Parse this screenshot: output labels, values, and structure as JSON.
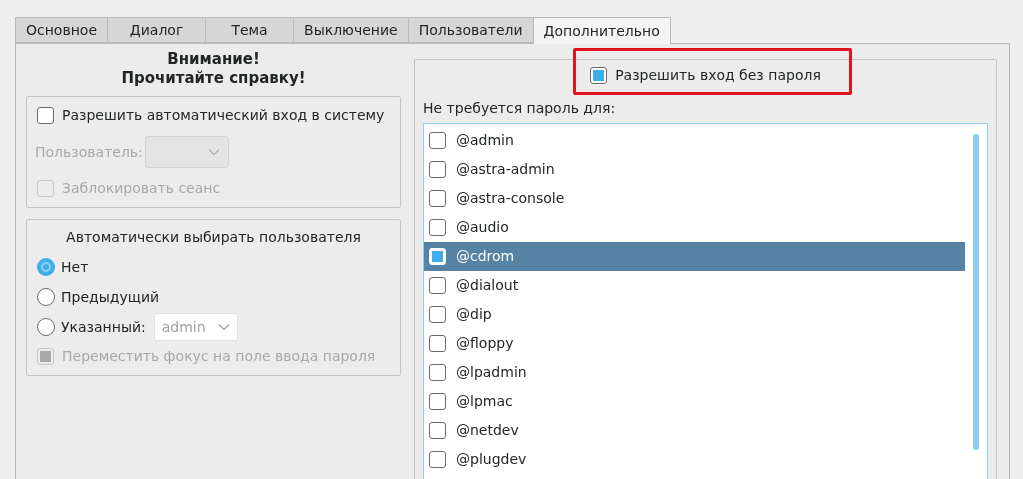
{
  "tabs": [
    {
      "label": "Основное",
      "selected": false
    },
    {
      "label": "Диалог",
      "selected": false
    },
    {
      "label": "Тема",
      "selected": false
    },
    {
      "label": "Выключение",
      "selected": false
    },
    {
      "label": "Пользователи",
      "selected": false
    },
    {
      "label": "Дополнительно",
      "selected": true
    }
  ],
  "warning": [
    "Внимание!",
    "Прочитайте справку!"
  ],
  "autologin": {
    "checkbox": {
      "label": "Разрешить автоматический вход в систему",
      "checked": false
    },
    "user_label": "Пользователь:",
    "user_disabled": true,
    "lock": {
      "label": "Заблокировать сеанс",
      "checked": false,
      "disabled": true
    }
  },
  "autoselect": {
    "title": "Автоматически выбирать пользователя",
    "options": [
      {
        "label": "Нет",
        "selected": true
      },
      {
        "label": "Предыдущий",
        "selected": false
      },
      {
        "label": "Указанный:",
        "selected": false
      }
    ],
    "specified_user": "admin",
    "focus": {
      "label": "Переместить фокус на поле ввода пароля",
      "checked": true,
      "disabled": true
    }
  },
  "nopassword": {
    "checkbox": {
      "label": "Разрешить вход без пароля",
      "checked": true
    },
    "list_label": "Не требуется пароль для:",
    "groups": [
      {
        "name": "@admin",
        "checked": false,
        "selected": false
      },
      {
        "name": "@astra-admin",
        "checked": false,
        "selected": false
      },
      {
        "name": "@astra-console",
        "checked": false,
        "selected": false
      },
      {
        "name": "@audio",
        "checked": false,
        "selected": false
      },
      {
        "name": "@cdrom",
        "checked": true,
        "selected": true
      },
      {
        "name": "@dialout",
        "checked": false,
        "selected": false
      },
      {
        "name": "@dip",
        "checked": false,
        "selected": false
      },
      {
        "name": "@floppy",
        "checked": false,
        "selected": false
      },
      {
        "name": "@lpadmin",
        "checked": false,
        "selected": false
      },
      {
        "name": "@lpmac",
        "checked": false,
        "selected": false
      },
      {
        "name": "@netdev",
        "checked": false,
        "selected": false
      },
      {
        "name": "@plugdev",
        "checked": false,
        "selected": false
      }
    ]
  }
}
